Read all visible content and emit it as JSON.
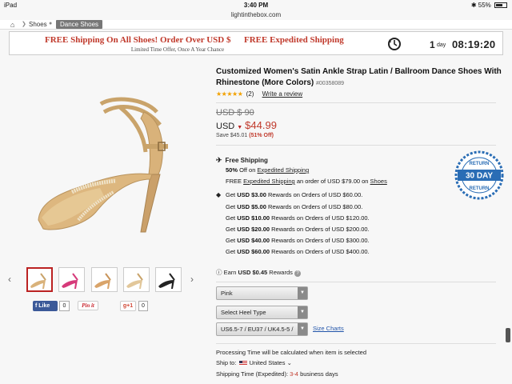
{
  "status": {
    "carrier": "iPad",
    "time": "3:40 PM",
    "battery": "55%"
  },
  "url": "lightinthebox.com",
  "breadcrumb": {
    "items": [
      "Shoes",
      "Dance Shoes"
    ]
  },
  "banner": {
    "line1": "FREE Shipping On All Shoes! Order Over USD $",
    "line1b": "FREE Expedited Shipping",
    "line2": "Limited Time Offer, Once A Year Chance",
    "countdown_days": "1",
    "countdown_unit": "day",
    "countdown_time": "08:19:20"
  },
  "product": {
    "title": "Customized Women's Satin Ankle Strap Latin / Ballroom Dance Shoes With Rhinestone (More Colors)",
    "sku": "#00358089",
    "stars": "★★★★★",
    "review_count": "(2)",
    "write_review": "Write a review",
    "original_price": "USD $ 90",
    "currency": "USD",
    "price": "$44.99",
    "save_text": "Save $45.01",
    "save_pct": "(51% Off)"
  },
  "shipping": {
    "heading": "Free Shipping",
    "l1_pct": "50%",
    "l1_mid": " Off on ",
    "l1_link": "Expedited Shipping",
    "l2_a": "FREE ",
    "l2_link": "Expedited Shipping",
    "l2_b": " an order of USD $79.00 on ",
    "l2_link2": "Shoes"
  },
  "rewards": [
    {
      "get": "Get ",
      "amt": "USD $3.00",
      "rest": " Rewards on Orders of USD $60.00."
    },
    {
      "get": "Get ",
      "amt": "USD $5.00",
      "rest": " Rewards on Orders of USD $80.00."
    },
    {
      "get": "Get ",
      "amt": "USD $10.00",
      "rest": " Rewards on Orders of USD $120.00."
    },
    {
      "get": "Get ",
      "amt": "USD $20.00",
      "rest": " Rewards on Orders of USD $200.00."
    },
    {
      "get": "Get ",
      "amt": "USD $40.00",
      "rest": " Rewards on Orders of USD $300.00."
    },
    {
      "get": "Get ",
      "amt": "USD $60.00",
      "rest": " Rewards on Orders of USD $400.00."
    }
  ],
  "earn": {
    "a": "Earn ",
    "amt": "USD $0.45",
    "b": " Rewards"
  },
  "selects": {
    "color": "Pink",
    "heel": "Select Heel Type",
    "size": "US6.5-7 / EU37 / UK4.5-5 /",
    "size_charts": "Size Charts"
  },
  "processing": "Processing Time will be calculated when item is selected",
  "ship_to": {
    "label": "Ship to:",
    "country": "United States"
  },
  "ship_time": {
    "label": "Shipping Time (Expedited): ",
    "days": "3-4",
    "unit": " business days"
  },
  "social": {
    "fb_label": "Like",
    "fb_count": "0",
    "pin_label": "Pin it",
    "gp_label": "g+1",
    "gp_count": "0"
  },
  "badge": {
    "top": "RETURN",
    "mid": "30 DAY",
    "bottom": "RETURN"
  },
  "colors": {
    "accent": "#c0392b",
    "fb": "#3b5998",
    "shoe": "#d9b27a"
  }
}
